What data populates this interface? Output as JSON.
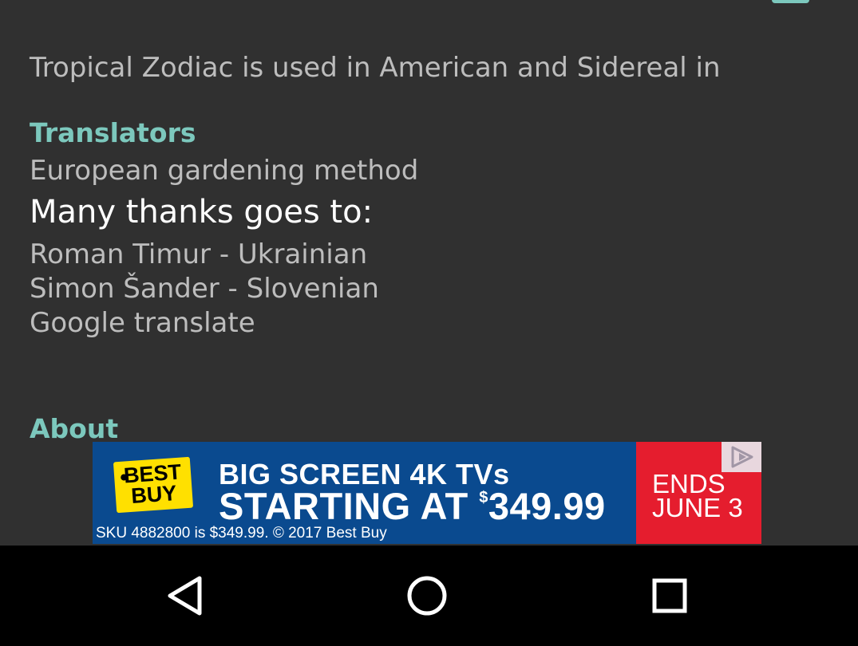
{
  "top_text": {
    "line1": "Tropical Zodiac is used in American and Sidereal in",
    "line2": "European gardening method"
  },
  "translators": {
    "header": "Translators",
    "thanks_title": "Many thanks goes to:",
    "items": [
      "Roman Timur - Ukrainian",
      "Simon Šander - Slovenian",
      "Google translate"
    ]
  },
  "about": {
    "header": "About"
  },
  "ad": {
    "logo_line1": "BEST",
    "logo_line2": "BUY",
    "headline1": "BIG SCREEN 4K TVs",
    "headline2_prefix": "STARTING AT ",
    "headline2_sup": "$",
    "headline2_price": "349.99",
    "fineprint": "SKU 4882800 is $349.99. © 2017 Best Buy",
    "ends_line1": "ENDS",
    "ends_line2": "JUNE 3",
    "adchoices_icon": "adchoices-icon"
  },
  "nav": {
    "back_icon": "back-triangle-icon",
    "home_icon": "home-circle-icon",
    "recents_icon": "recents-square-icon"
  },
  "colors": {
    "background": "#303030",
    "accent": "#7cc8bd",
    "secondary_text": "#bdbdbd",
    "primary_text": "#ffffff",
    "ad_blue": "#0a4a8f",
    "ad_red": "#e51d2e",
    "ad_yellow": "#ffe000",
    "nav_bar": "#000000"
  }
}
